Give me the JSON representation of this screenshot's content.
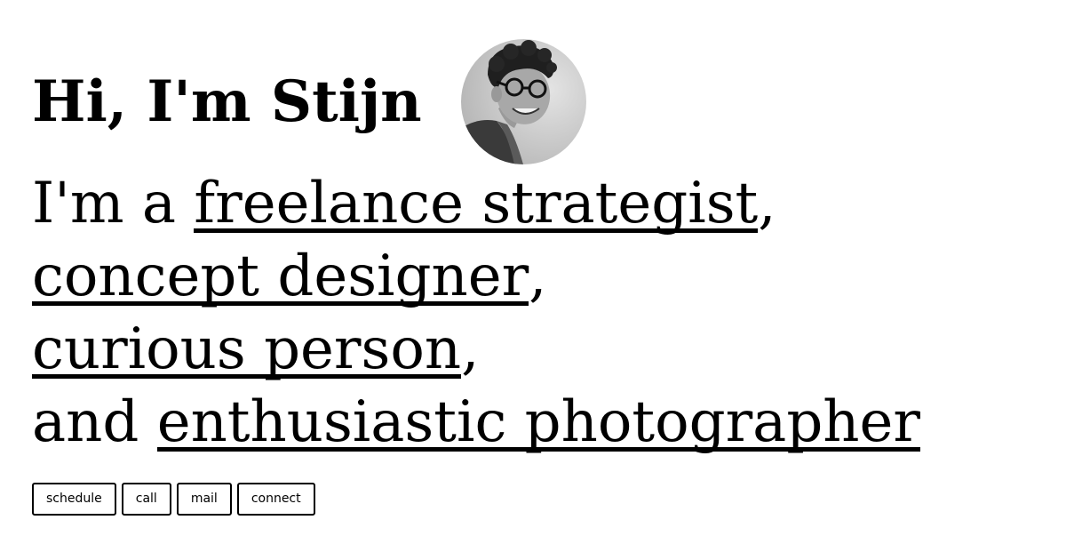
{
  "header": {
    "greeting": "Hi, I'm Stijn"
  },
  "avatar": {
    "alt": "Stijn"
  },
  "intro": {
    "prefix": "I'm a ",
    "roles": [
      {
        "label": "freelance strategist",
        "suffix": ","
      },
      {
        "label": "concept designer",
        "suffix": ","
      },
      {
        "label": "curious person",
        "suffix": ","
      },
      {
        "label": "enthusiastic photographer",
        "suffix": ""
      }
    ],
    "last_prefix": "and "
  },
  "actions": {
    "schedule": "schedule",
    "call": "call",
    "mail": "mail",
    "connect": "connect"
  }
}
